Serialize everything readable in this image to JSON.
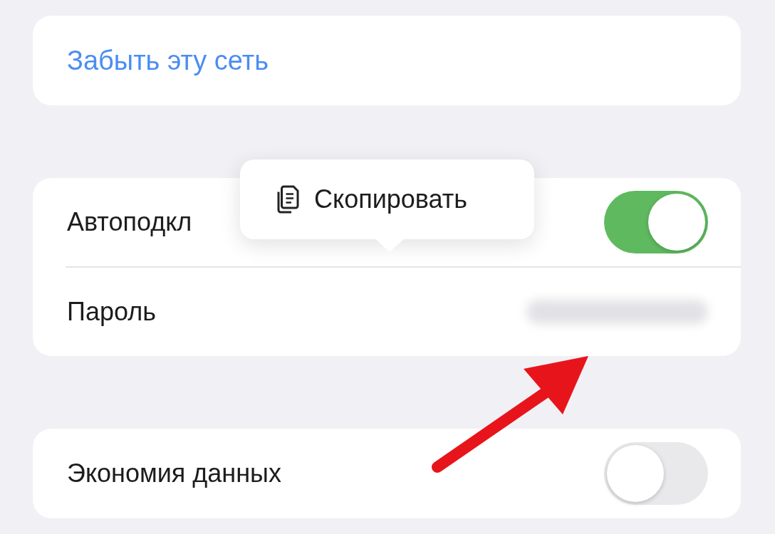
{
  "forget_network": {
    "label": "Забыть эту сеть"
  },
  "settings": [
    {
      "kind": "toggle",
      "label": "Автоподкл",
      "on": true
    },
    {
      "kind": "password",
      "label": "Пароль",
      "blurred": true
    }
  ],
  "data_saving": {
    "kind": "toggle",
    "label": "Экономия данных",
    "on": false
  },
  "context_menu": {
    "items": [
      {
        "label": "Скопировать"
      }
    ]
  }
}
